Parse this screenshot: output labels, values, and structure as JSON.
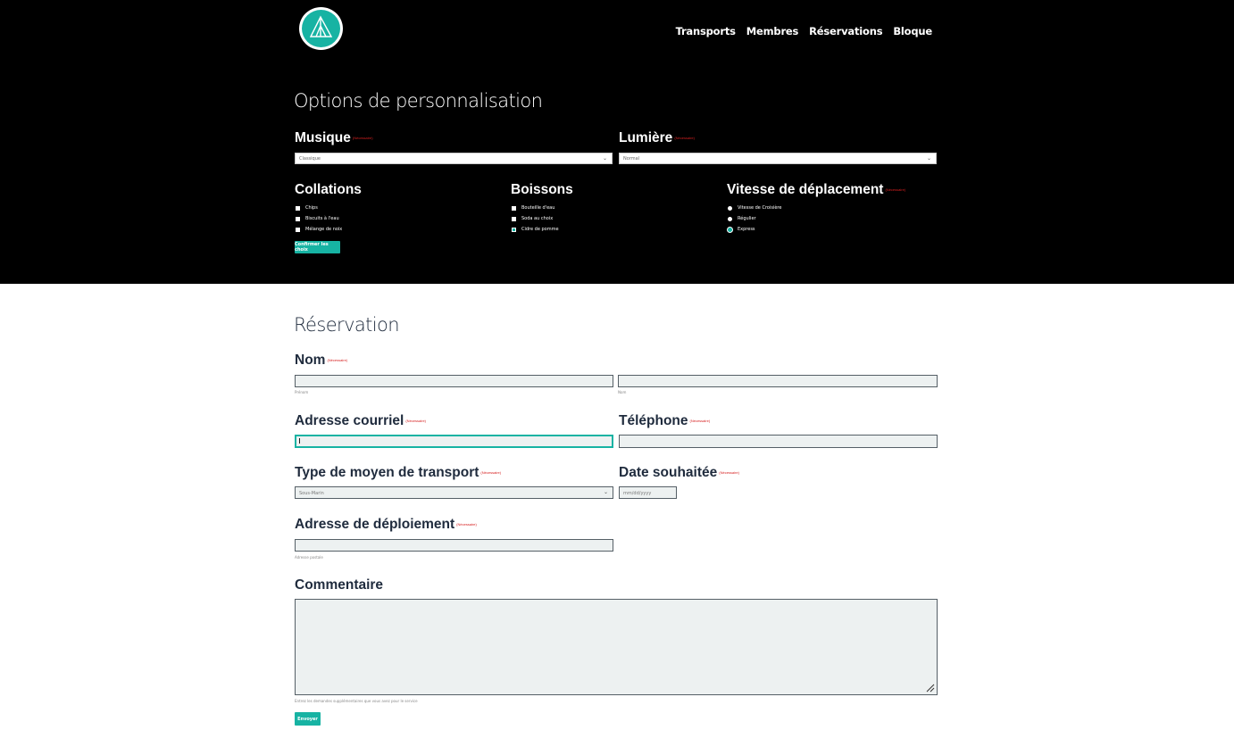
{
  "nav": {
    "items": [
      "Transports",
      "Membres",
      "Réservations",
      "Bloque"
    ]
  },
  "options": {
    "title": "Options de personnalisation",
    "required": "(Nécessaire)",
    "musique": {
      "label": "Musique",
      "value": "Classique"
    },
    "lumiere": {
      "label": "Lumière",
      "value": "Normal"
    },
    "collations": {
      "label": "Collations",
      "items": [
        "Chips",
        "Biscuits à l'eau",
        "Mélange de noix"
      ]
    },
    "boissons": {
      "label": "Boissons",
      "items": [
        "Bouteille d'eau",
        "Soda au choix",
        "Cidre de pomme"
      ],
      "checked_index": 2
    },
    "vitesse": {
      "label": "Vitesse de déplacement",
      "items": [
        "Vitesse de Croisière",
        "Régulier",
        "Express"
      ],
      "selected_index": 2
    },
    "confirm_button": "Confirmer les choix"
  },
  "reservation": {
    "title": "Réservation",
    "required": "(Nécessaire)",
    "nom": {
      "label": "Nom",
      "first_hint": "Prénom",
      "last_hint": "Nom"
    },
    "email": {
      "label": "Adresse courriel"
    },
    "telephone": {
      "label": "Téléphone"
    },
    "transport": {
      "label": "Type de moyen de transport",
      "value": "Sous-Marin"
    },
    "date": {
      "label": "Date souhaitée",
      "placeholder": "mm/dd/yyyy"
    },
    "adresse": {
      "label": "Adresse de déploiement",
      "hint": "Adresse postale"
    },
    "commentaire": {
      "label": "Commentaire",
      "hint": "Entrez les demandes supplémentaires que vous avez pour le service"
    },
    "submit_button": "Envoyer"
  },
  "colors": {
    "accent": "#17b3a3",
    "required": "#d62020",
    "dark_bg": "#000000",
    "field_bg": "#edf1f1"
  }
}
